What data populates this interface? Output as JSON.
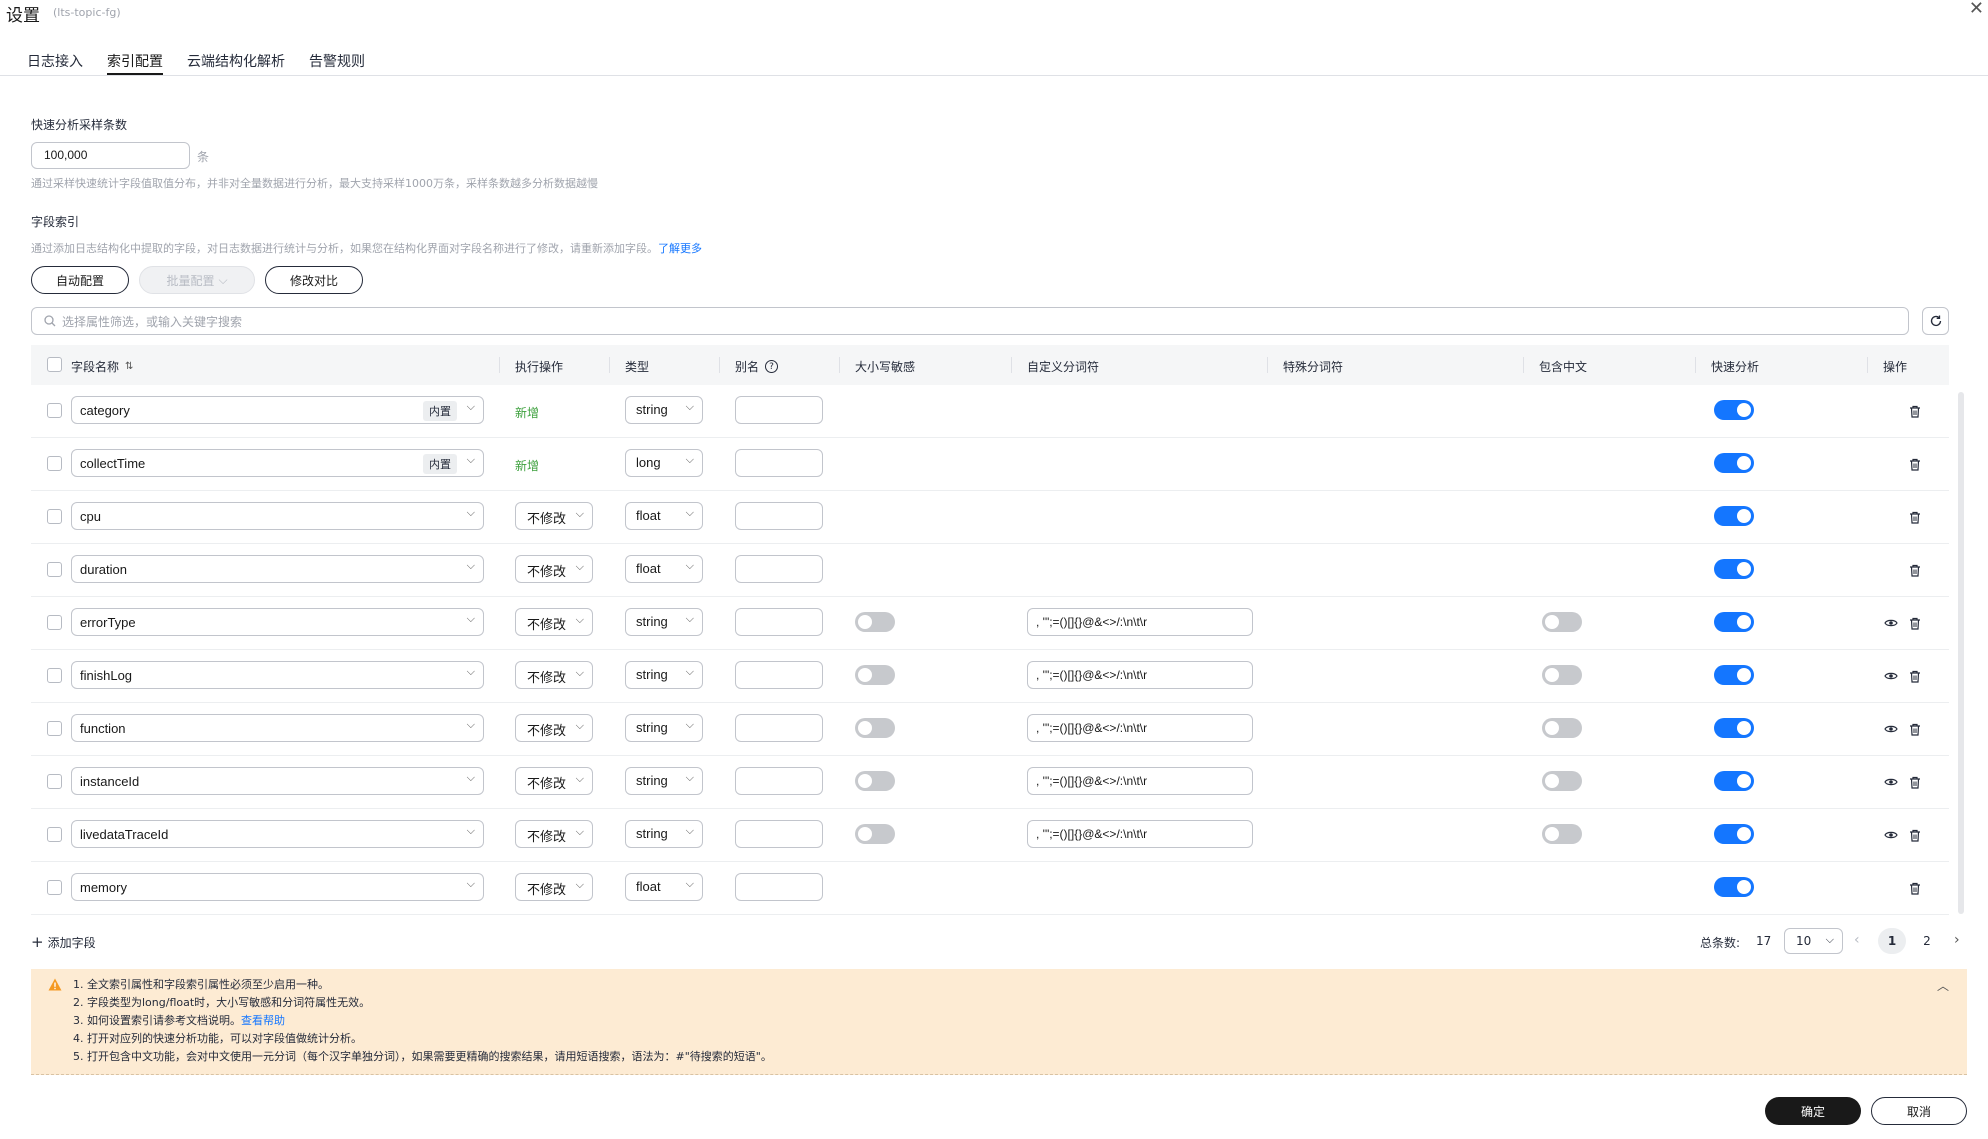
{
  "header": {
    "title": "设置",
    "subtitle": "(lts-topic-fg)"
  },
  "tabs": [
    {
      "label": "日志接入"
    },
    {
      "label": "索引配置"
    },
    {
      "label": "云端结构化解析"
    },
    {
      "label": "告警规则"
    }
  ],
  "sampling": {
    "label": "快速分析采样条数",
    "value": "100,000",
    "unit": "条",
    "hint": "通过采样快速统计字段值取值分布，并非对全量数据进行分析，最大支持采样1000万条，采样条数越多分析数据越慢"
  },
  "field_index": {
    "label": "字段索引",
    "hint": "通过添加日志结构化中提取的字段，对日志数据进行统计与分析，如果您在结构化界面对字段名称进行了修改，请重新添加字段。",
    "learn_more": "了解更多"
  },
  "toolbar": {
    "auto_config": "自动配置",
    "batch_config": "批量配置",
    "diff": "修改对比"
  },
  "search": {
    "placeholder": "选择属性筛选，或输入关键字搜索"
  },
  "columns": {
    "name": "字段名称",
    "operation": "执行操作",
    "type": "类型",
    "alias": "别名",
    "case_sensitive": "大小写敏感",
    "custom_delimiter": "自定义分词符",
    "special_delimiter": "特殊分词符",
    "contains_chinese": "包含中文",
    "quick_analysis": "快速分析",
    "actions": "操作"
  },
  "rows": [
    {
      "name": "category",
      "tag": "内置",
      "op": "新增",
      "op_kind": "new",
      "type": "string",
      "text": false,
      "delimiter": "",
      "quick": true
    },
    {
      "name": "collectTime",
      "tag": "内置",
      "op": "新增",
      "op_kind": "new",
      "type": "long",
      "text": false,
      "delimiter": "",
      "quick": true
    },
    {
      "name": "cpu",
      "tag": "",
      "op": "不修改",
      "op_kind": "select",
      "type": "float",
      "text": false,
      "delimiter": "",
      "quick": true
    },
    {
      "name": "duration",
      "tag": "",
      "op": "不修改",
      "op_kind": "select",
      "type": "float",
      "text": false,
      "delimiter": "",
      "quick": true
    },
    {
      "name": "errorType",
      "tag": "",
      "op": "不修改",
      "op_kind": "select",
      "type": "string",
      "text": true,
      "case": false,
      "delimiter": ", '\";=()[]{}@&<>/:\\n\\t\\r",
      "chinese": false,
      "quick": true
    },
    {
      "name": "finishLog",
      "tag": "",
      "op": "不修改",
      "op_kind": "select",
      "type": "string",
      "text": true,
      "case": false,
      "delimiter": ", '\";=()[]{}@&<>/:\\n\\t\\r",
      "chinese": false,
      "quick": true
    },
    {
      "name": "function",
      "tag": "",
      "op": "不修改",
      "op_kind": "select",
      "type": "string",
      "text": true,
      "case": false,
      "delimiter": ", '\";=()[]{}@&<>/:\\n\\t\\r",
      "chinese": false,
      "quick": true
    },
    {
      "name": "instanceId",
      "tag": "",
      "op": "不修改",
      "op_kind": "select",
      "type": "string",
      "text": true,
      "case": false,
      "delimiter": ", '\";=()[]{}@&<>/:\\n\\t\\r",
      "chinese": false,
      "quick": true
    },
    {
      "name": "livedataTraceId",
      "tag": "",
      "op": "不修改",
      "op_kind": "select",
      "type": "string",
      "text": true,
      "case": false,
      "delimiter": ", '\";=()[]{}@&<>/:\\n\\t\\r",
      "chinese": false,
      "quick": true
    },
    {
      "name": "memory",
      "tag": "",
      "op": "不修改",
      "op_kind": "select",
      "type": "float",
      "text": false,
      "delimiter": "",
      "quick": true
    }
  ],
  "footer": {
    "add_field": "添加字段",
    "total_label": "总条数:",
    "total": "17",
    "page_size": "10",
    "pages": [
      "1",
      "2"
    ],
    "current_page": "1"
  },
  "notice": {
    "items": [
      "1. 全文索引属性和字段索引属性必须至少启用一种。",
      "2. 字段类型为long/float时，大小写敏感和分词符属性无效。",
      "3. 如何设置索引请参考文档说明。",
      "4. 打开对应列的快速分析功能，可以对字段值做统计分析。",
      "5. 打开包含中文功能，会对中文使用一元分词（每个汉字单独分词），如果需要更精确的搜索结果，请用短语搜索，语法为：#\"待搜索的短语\"。"
    ],
    "help_link": "查看帮助"
  },
  "buttons": {
    "ok": "确定",
    "cancel": "取消"
  },
  "colors": {
    "accent": "#1476ff",
    "new_op": "#3ca03c",
    "notice_bg": "#fdebd3",
    "warn": "#f59a23"
  }
}
